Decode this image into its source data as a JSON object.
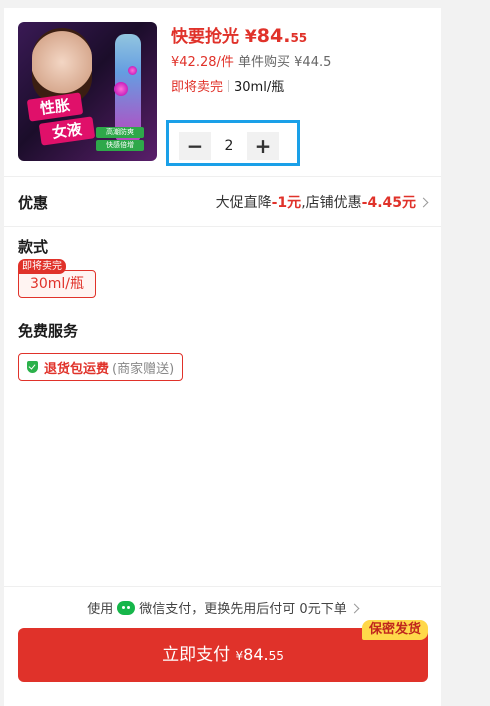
{
  "product": {
    "price_prefix": "快要抢光",
    "price_symbol": "¥",
    "price_int": "84.",
    "price_dec": "55",
    "unit_price": "¥42.28/件",
    "single_buy": "单件购买 ¥44.5",
    "stock_status": "即将卖完",
    "spec": "30ml/瓶",
    "image_text": {
      "tag_line1": "性胀",
      "tag_line2": "女液",
      "pill1": "高潮防爽",
      "pill2": "快感倍增"
    }
  },
  "quantity": {
    "minus": "−",
    "value": "2",
    "plus": "+"
  },
  "promotion": {
    "label": "优惠",
    "text1": "大促直降",
    "amount1": "-1元",
    "comma": ",",
    "text2": "店铺优惠",
    "amount2": "-4.45元"
  },
  "style_section": {
    "label": "款式",
    "badge": "即将卖完",
    "option": "30ml/瓶"
  },
  "service_section": {
    "label": "免费服务",
    "service": "退货包运费",
    "note": "(商家赠送)"
  },
  "payment": {
    "tip_prefix": "使用",
    "tip_suffix": "微信支付，更换先用后付可 0元下单",
    "button_label": "立即支付",
    "currency": "¥",
    "amount_int": "84.",
    "amount_dec": "55",
    "secret_badge": "保密发货"
  },
  "colors": {
    "accent_red": "#e0322a",
    "highlight_blue": "#1aa0e8",
    "wechat_green": "#16b64a",
    "badge_yellow": "#ffd84a"
  }
}
